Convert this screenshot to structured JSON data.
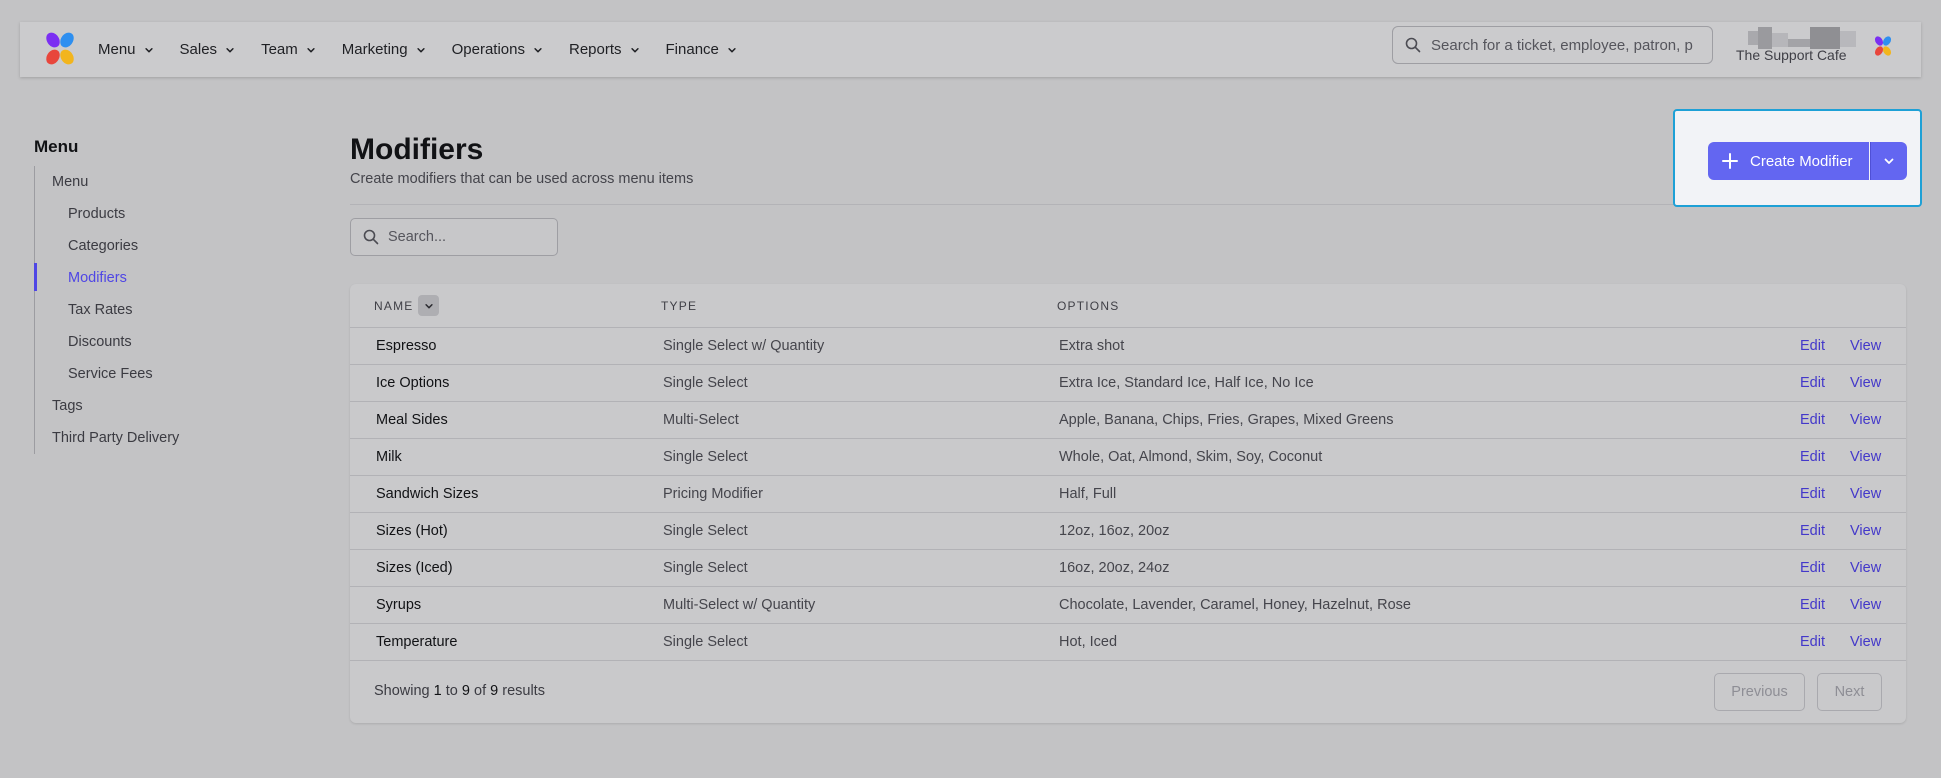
{
  "nav": {
    "items": [
      {
        "label": "Menu"
      },
      {
        "label": "Sales"
      },
      {
        "label": "Team"
      },
      {
        "label": "Marketing"
      },
      {
        "label": "Operations"
      },
      {
        "label": "Reports"
      },
      {
        "label": "Finance"
      }
    ],
    "search_placeholder": "Search for a ticket, employee, patron, p",
    "org_name": "The Support Cafe"
  },
  "sidebar": {
    "title": "Menu",
    "items": [
      {
        "label": "Menu"
      },
      {
        "label": "Products"
      },
      {
        "label": "Categories"
      },
      {
        "label": "Modifiers"
      },
      {
        "label": "Tax Rates"
      },
      {
        "label": "Discounts"
      },
      {
        "label": "Service Fees"
      },
      {
        "label": "Tags"
      },
      {
        "label": "Third Party Delivery"
      }
    ],
    "active": "Modifiers"
  },
  "header": {
    "title": "Modifiers",
    "subtitle": "Create modifiers that can be used across menu items",
    "create_label": "Create Modifier"
  },
  "list_search": {
    "placeholder": "Search..."
  },
  "table": {
    "columns": [
      "Name",
      "Type",
      "Options"
    ],
    "rows": [
      {
        "name": "Espresso",
        "type": "Single Select w/ Quantity",
        "options": "Extra shot",
        "edit": "Edit",
        "view": "View"
      },
      {
        "name": "Ice Options",
        "type": "Single Select",
        "options": "Extra Ice, Standard Ice, Half Ice, No Ice",
        "edit": "Edit",
        "view": "View"
      },
      {
        "name": "Meal Sides",
        "type": "Multi-Select",
        "options": "Apple, Banana, Chips, Fries, Grapes, Mixed Greens",
        "edit": "Edit",
        "view": "View"
      },
      {
        "name": "Milk",
        "type": "Single Select",
        "options": "Whole, Oat, Almond, Skim, Soy, Coconut",
        "edit": "Edit",
        "view": "View"
      },
      {
        "name": "Sandwich Sizes",
        "type": "Pricing Modifier",
        "options": "Half, Full",
        "edit": "Edit",
        "view": "View"
      },
      {
        "name": "Sizes (Hot)",
        "type": "Single Select",
        "options": "12oz, 16oz, 20oz",
        "edit": "Edit",
        "view": "View"
      },
      {
        "name": "Sizes (Iced)",
        "type": "Single Select",
        "options": "16oz, 20oz, 24oz",
        "edit": "Edit",
        "view": "View"
      },
      {
        "name": "Syrups",
        "type": "Multi-Select w/ Quantity",
        "options": "Chocolate, Lavender, Caramel, Honey, Hazelnut, Rose",
        "edit": "Edit",
        "view": "View"
      },
      {
        "name": "Temperature",
        "type": "Single Select",
        "options": "Hot, Iced",
        "edit": "Edit",
        "view": "View"
      }
    ]
  },
  "footer": {
    "showing_prefix": "Showing",
    "from": "1",
    "to_word": "to",
    "to": "9",
    "of_word": "of",
    "total": "9",
    "results_word": "results",
    "previous": "Previous",
    "next": "Next"
  },
  "colors": {
    "accent": "#6366f1",
    "link": "#4338ca",
    "focus_ring": "#1ea0d6"
  },
  "icons": [
    "app-logo-icon",
    "chevron-down-icon",
    "search-icon",
    "plus-icon"
  ]
}
